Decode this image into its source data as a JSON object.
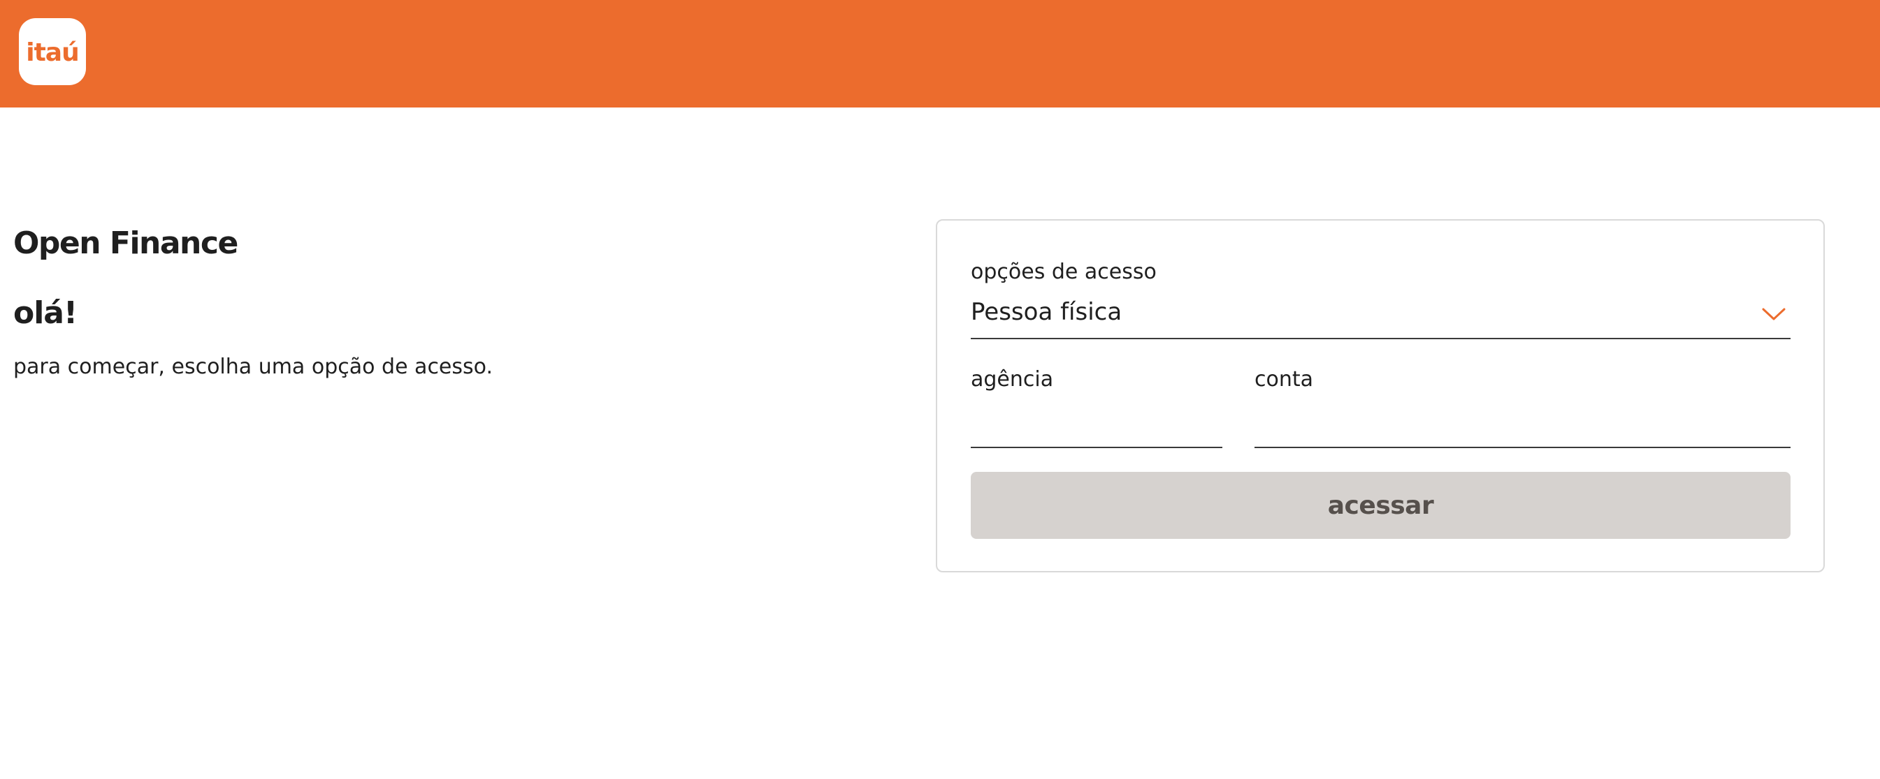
{
  "header": {
    "logo_text": "itaú",
    "brand_color": "#ec6c2d"
  },
  "intro": {
    "title": "Open Finance",
    "greeting": "olá!",
    "instructions": "para começar, escolha uma opção de acesso."
  },
  "form": {
    "access_option": {
      "label": "opções de acesso",
      "selected_value": "Pessoa física",
      "icon": "chevron-down-icon"
    },
    "agency": {
      "label": "agência",
      "value": ""
    },
    "account": {
      "label": "conta",
      "value": ""
    },
    "submit_label": "acessar"
  },
  "colors": {
    "accent": "#ec6c2d",
    "button_disabled_bg": "#d6d2cf",
    "button_disabled_text": "#56504c",
    "text": "#1f1f1f"
  }
}
